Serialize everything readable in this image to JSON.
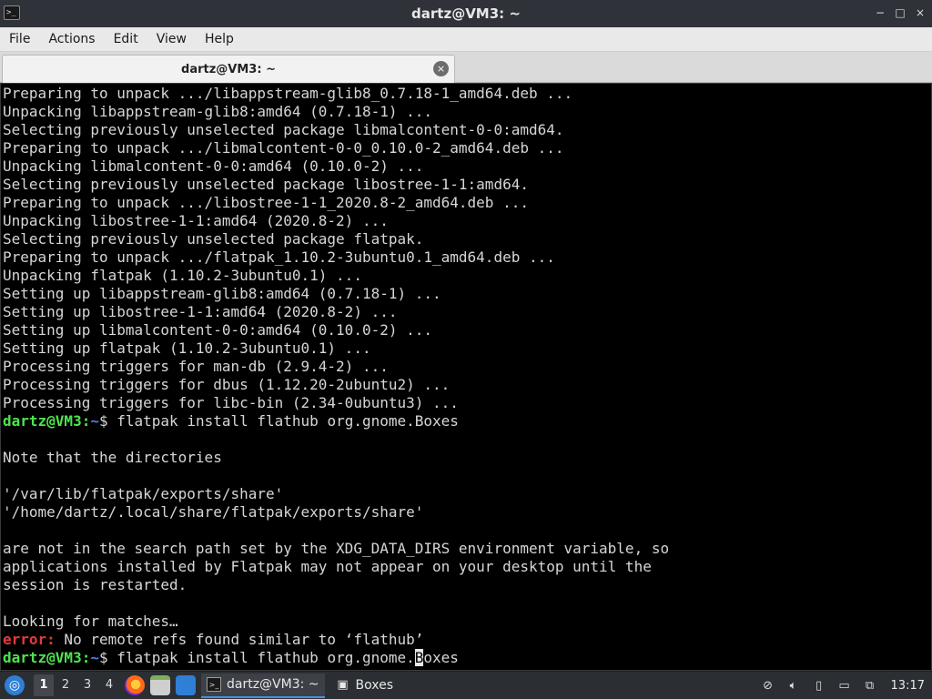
{
  "window": {
    "title": "dartz@VM3: ~",
    "controls": [
      "−",
      "□",
      "×"
    ]
  },
  "menu": [
    "File",
    "Actions",
    "Edit",
    "View",
    "Help"
  ],
  "tab": {
    "label": "dartz@VM3: ~",
    "close_glyph": "×"
  },
  "terminal": {
    "lines": [
      "Preparing to unpack .../libappstream-glib8_0.7.18-1_amd64.deb ...",
      "Unpacking libappstream-glib8:amd64 (0.7.18-1) ...",
      "Selecting previously unselected package libmalcontent-0-0:amd64.",
      "Preparing to unpack .../libmalcontent-0-0_0.10.0-2_amd64.deb ...",
      "Unpacking libmalcontent-0-0:amd64 (0.10.0-2) ...",
      "Selecting previously unselected package libostree-1-1:amd64.",
      "Preparing to unpack .../libostree-1-1_2020.8-2_amd64.deb ...",
      "Unpacking libostree-1-1:amd64 (2020.8-2) ...",
      "Selecting previously unselected package flatpak.",
      "Preparing to unpack .../flatpak_1.10.2-3ubuntu0.1_amd64.deb ...",
      "Unpacking flatpak (1.10.2-3ubuntu0.1) ...",
      "Setting up libappstream-glib8:amd64 (0.7.18-1) ...",
      "Setting up libostree-1-1:amd64 (2020.8-2) ...",
      "Setting up libmalcontent-0-0:amd64 (0.10.0-2) ...",
      "Setting up flatpak (1.10.2-3ubuntu0.1) ...",
      "Processing triggers for man-db (2.9.4-2) ...",
      "Processing triggers for dbus (1.12.20-2ubuntu2) ...",
      "Processing triggers for libc-bin (2.34-0ubuntu3) ..."
    ],
    "prompt_user": "dartz@VM3",
    "prompt_sep": ":",
    "prompt_path": "~",
    "prompt_dollar": "$ ",
    "command1": "flatpak install flathub org.gnome.Boxes",
    "output": [
      "",
      "Note that the directories",
      "",
      "'/var/lib/flatpak/exports/share'",
      "'/home/dartz/.local/share/flatpak/exports/share'",
      "",
      "are not in the search path set by the XDG_DATA_DIRS environment variable, so",
      "applications installed by Flatpak may not appear on your desktop until the",
      "session is restarted.",
      "",
      "Looking for matches…"
    ],
    "error_label": "error:",
    "error_text": " No remote refs found similar to ‘flathub’",
    "command2_before_cursor": "flatpak install flathub org.gnome.",
    "command2_cursor_char": "B",
    "command2_after_cursor": "oxes"
  },
  "taskbar": {
    "workspaces": [
      "1",
      "2",
      "3",
      "4"
    ],
    "active_workspace": "1",
    "tasks": [
      {
        "label": "dartz@VM3: ~",
        "icon": "terminal-icon"
      },
      {
        "label": "Boxes",
        "icon": "boxes-icon"
      }
    ],
    "clock": "13:17"
  },
  "colors": {
    "prompt_user": "#4ee44e",
    "prompt_path": "#4f7cf7",
    "error": "#e23b3b"
  }
}
